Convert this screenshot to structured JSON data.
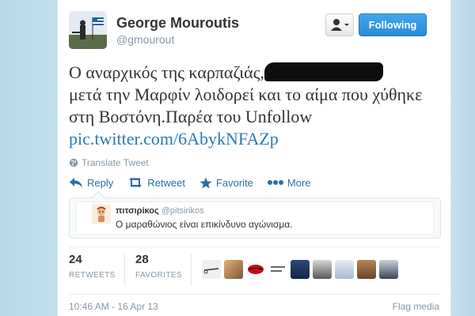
{
  "user": {
    "name": "George Mouroutis",
    "handle": "@gmourout",
    "follow_label": "Following"
  },
  "tweet": {
    "text_part1": "Ο αναρχικός της καρπαζιάς,",
    "text_part2": "μετά την Μαρφίν λοιδορεί και το αίμα που χύθηκε στη Βοστόνη.Παρέα του Unfollow",
    "link": "pic.twitter.com/6AbykNFAZp"
  },
  "translate_label": "Translate Tweet",
  "actions": [
    {
      "label": "Reply",
      "icon": "reply-icon"
    },
    {
      "label": "Retweet",
      "icon": "retweet-icon"
    },
    {
      "label": "Favorite",
      "icon": "star-icon"
    },
    {
      "label": "More",
      "icon": "more-dots-icon"
    }
  ],
  "quoted": {
    "name": "πιτσιρίκος",
    "handle": "@pitsirikos",
    "text": "Ο μαραθώνιος είναι επικίνδυνο αγώνισμα."
  },
  "stats": {
    "retweets": "24",
    "retweets_label": "RETWEETS",
    "favorites": "28",
    "favorites_label": "FAVORITES"
  },
  "timestamp": "10:46 AM - 16 Apr 13",
  "flag_label": "Flag media",
  "colors": {
    "accent": "#2a8cd8",
    "link": "#2a7ab8",
    "muted": "#8899a6",
    "background": "#c0deed"
  }
}
